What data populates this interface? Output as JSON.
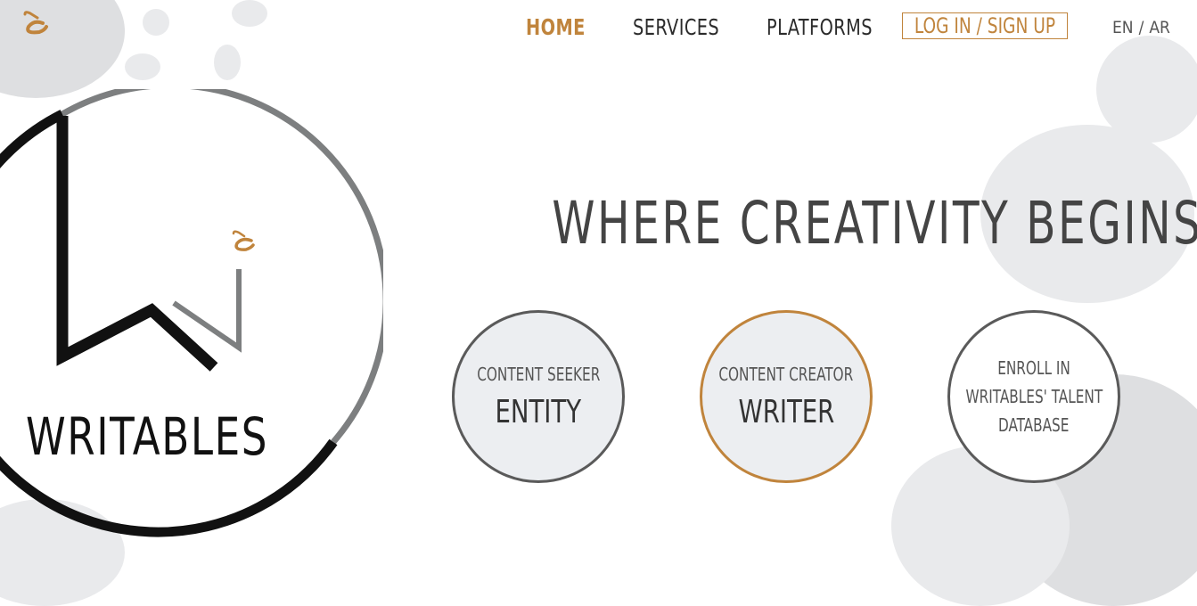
{
  "nav": {
    "home": "HOME",
    "services": "SERVICES",
    "platforms": "PLATFORMS",
    "login": "LOG IN / SIGN UP",
    "lang_en": "EN",
    "lang_sep": "/",
    "lang_ar": "AR"
  },
  "logo": {
    "wordmark": "WRITABLES"
  },
  "hero": {
    "headline": "WHERE CREATIVITY BEGINS"
  },
  "cards": {
    "entity": {
      "small": "CONTENT SEEKER",
      "big": "ENTITY"
    },
    "writer": {
      "small": "CONTENT CREATOR",
      "big": "WRITER"
    },
    "enroll": {
      "lines": [
        "ENROLL IN",
        "WRITABLES' TALENT",
        "DATABASE"
      ]
    }
  },
  "colors": {
    "accent": "#c0843c",
    "text": "#444444",
    "ring_dark": "#111111",
    "ring_grey": "#7d7f80",
    "card_bg": "#eceef1"
  },
  "icons": {
    "top_logo": "writables-mark-icon"
  }
}
